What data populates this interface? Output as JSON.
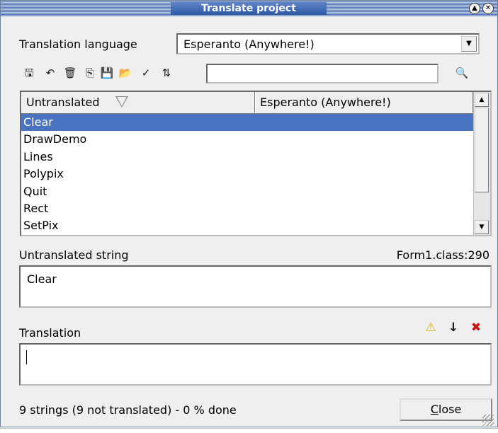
{
  "window": {
    "title": "Translate project"
  },
  "language": {
    "label": "Translation language",
    "selected": "Esperanto (Anywhere!)"
  },
  "toolbar": {
    "icons": [
      "save-icon",
      "undo-icon",
      "delete-icon",
      "copy-icon",
      "floppy-icon",
      "open-folder-icon",
      "verify-icon",
      "sort-icon"
    ],
    "search_value": "",
    "search_icon": "binoculars-icon"
  },
  "table": {
    "columns": [
      "Untranslated",
      "Esperanto (Anywhere!)"
    ],
    "rows": [
      "Clear",
      "DrawDemo",
      "Lines",
      "Polypix",
      "Quit",
      "Rect",
      "SetPix"
    ],
    "selected_index": 0
  },
  "untranslated": {
    "label": "Untranslated string",
    "source": "Form1.class:290",
    "value": "Clear"
  },
  "translation": {
    "label": "Translation",
    "value": ""
  },
  "status": "9 strings (9 not translated) - 0 % done",
  "close_button": {
    "mnemonic": "C",
    "rest": "lose"
  }
}
